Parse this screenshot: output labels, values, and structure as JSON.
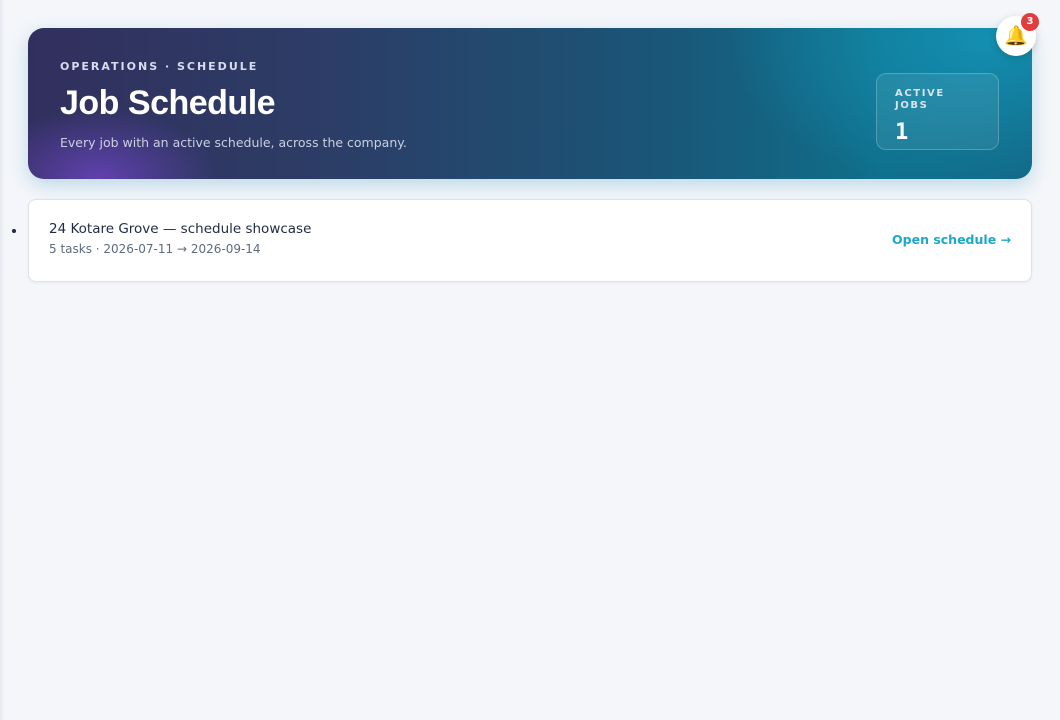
{
  "header": {
    "eyebrow": "OPERATIONS · SCHEDULE",
    "title": "Job Schedule",
    "subtitle": "Every job with an active schedule, across the company."
  },
  "stats": {
    "active_jobs_label": "ACTIVE JOBS",
    "active_jobs_value": "1"
  },
  "notifications": {
    "icon": "bell-icon",
    "count": "3"
  },
  "jobs": [
    {
      "title": "24 Kotare Grove — schedule showcase",
      "meta": "5 tasks · 2026-07-11 → 2026-09-14",
      "link_label": "Open schedule →"
    }
  ],
  "colors": {
    "accent": "#1ea7c9",
    "badge": "#e03e3e",
    "bell": "#f2b01e"
  }
}
